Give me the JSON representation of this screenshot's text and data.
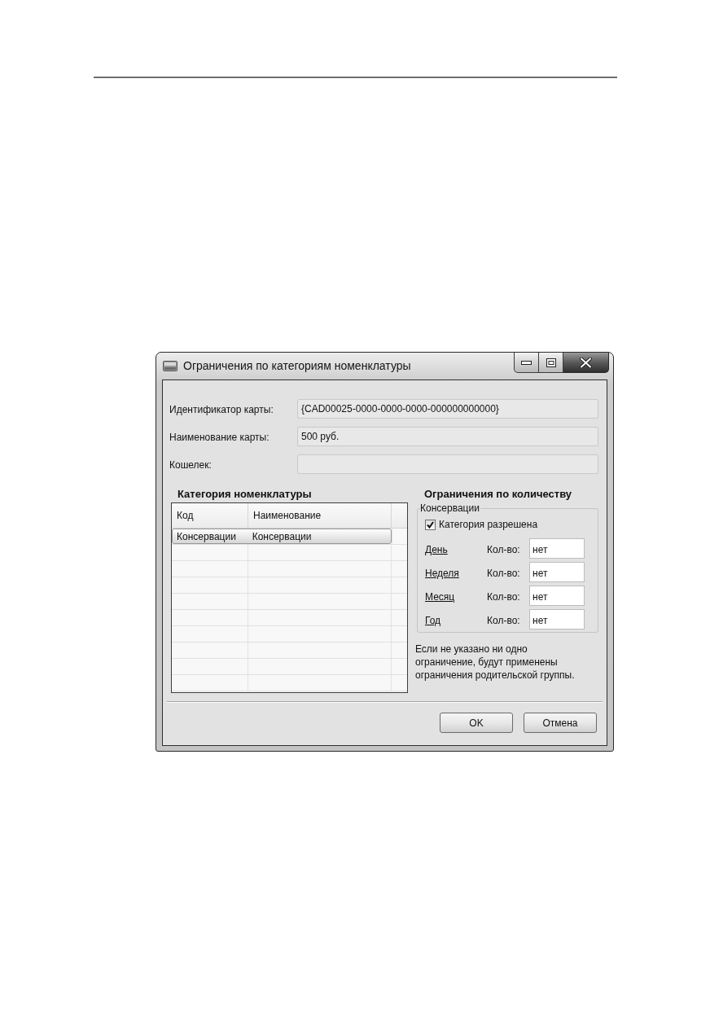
{
  "window": {
    "title": "Ограничения по категориям номенклатуры"
  },
  "fields": [
    {
      "label": "Идентификатор карты:",
      "value": "{CAD00025-0000-0000-0000-000000000000}"
    },
    {
      "label": "Наименование карты:",
      "value": "500 руб."
    },
    {
      "label": "Кошелек:"
    }
  ],
  "category_table": {
    "title": "Категория номенклатуры",
    "columns": [
      "Код",
      "Наименование"
    ],
    "rows": [
      {
        "cells": [
          "Консервации",
          "Консервации"
        ],
        "selected": true
      }
    ]
  },
  "limits": {
    "title": "Ограничения по количеству",
    "group": "Консервации",
    "allowed": {
      "label": "Категория разрешена",
      "checked": true
    },
    "periods": [
      {
        "label": "День",
        "quantity_label": "Кол-во:",
        "value": "нет"
      },
      {
        "label": "Неделя",
        "quantity_label": "Кол-во:",
        "value": "нет"
      },
      {
        "label": "Месяц",
        "quantity_label": "Кол-во:",
        "value": "нет"
      },
      {
        "label": "Год",
        "quantity_label": "Кол-во:",
        "value": "нет"
      }
    ],
    "note": "Если не указано ни одно ограничение, будут применены ограничения родительской группы."
  },
  "buttons": [
    {
      "label": "OK"
    },
    {
      "label": "Отмена"
    }
  ]
}
